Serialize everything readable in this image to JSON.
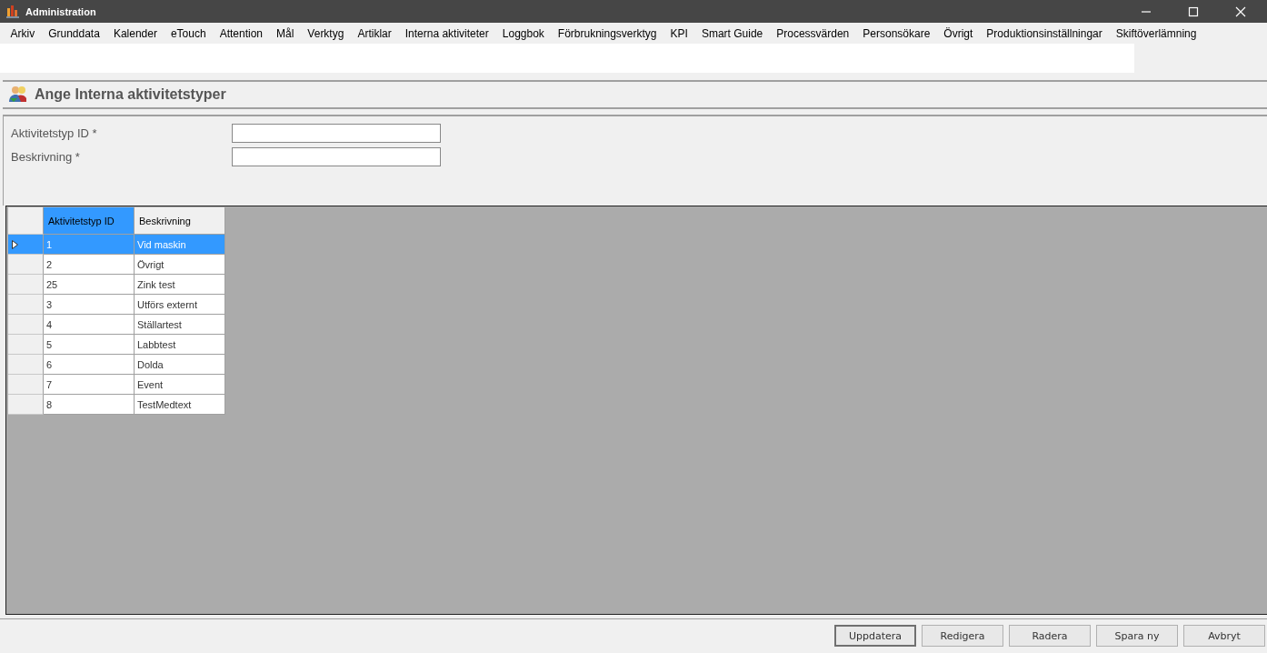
{
  "window": {
    "title": "Administration"
  },
  "menu": [
    "Arkiv",
    "Grunddata",
    "Kalender",
    "eTouch",
    "Attention",
    "Mål",
    "Verktyg",
    "Artiklar",
    "Interna aktiviteter",
    "Loggbok",
    "Förbrukningsverktyg",
    "KPI",
    "Smart Guide",
    "Processvärden",
    "Personsökare",
    "Övrigt",
    "Produktionsinställningar",
    "Skiftöverlämning"
  ],
  "page": {
    "title": "Ange Interna aktivitetstyper"
  },
  "form": {
    "fields": [
      {
        "label": "Aktivitetstyp ID *"
      },
      {
        "label": "Beskrivning *"
      }
    ]
  },
  "table": {
    "columns": [
      {
        "label": "Aktivitetstyp ID",
        "selected": true
      },
      {
        "label": "Beskrivning",
        "selected": false
      }
    ],
    "rows": [
      {
        "cells": [
          "1",
          "Vid maskin"
        ],
        "selected": true
      },
      {
        "cells": [
          "2",
          "Övrigt"
        ],
        "selected": false
      },
      {
        "cells": [
          "25",
          "Zink test"
        ],
        "selected": false
      },
      {
        "cells": [
          "3",
          "Utförs externt"
        ],
        "selected": false
      },
      {
        "cells": [
          "4",
          "Ställartest"
        ],
        "selected": false
      },
      {
        "cells": [
          "5",
          "Labbtest"
        ],
        "selected": false
      },
      {
        "cells": [
          "6",
          "Dolda"
        ],
        "selected": false
      },
      {
        "cells": [
          "7",
          "Event"
        ],
        "selected": false
      },
      {
        "cells": [
          "8",
          "TestMedtext"
        ],
        "selected": false
      }
    ]
  },
  "buttons": [
    {
      "label": "Uppdatera",
      "default": true
    },
    {
      "label": "Redigera",
      "default": false
    },
    {
      "label": "Radera",
      "default": false
    },
    {
      "label": "Spara ny",
      "default": false
    },
    {
      "label": "Avbryt",
      "default": false
    }
  ]
}
